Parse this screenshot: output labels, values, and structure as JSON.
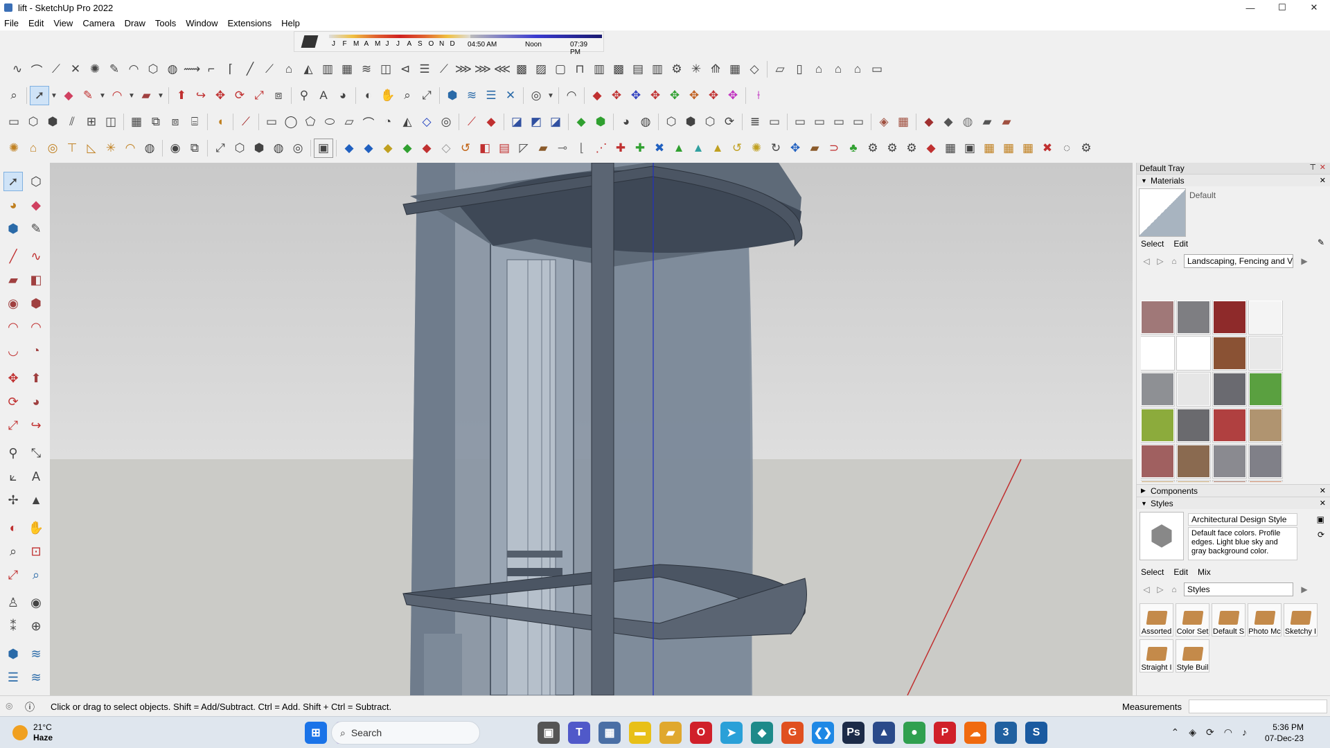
{
  "window": {
    "title": "lift - SketchUp Pro 2022",
    "minimize": "—",
    "maximize": "☐",
    "close": "✕"
  },
  "menu": [
    "File",
    "Edit",
    "View",
    "Camera",
    "Draw",
    "Tools",
    "Window",
    "Extensions",
    "Help"
  ],
  "shadows": {
    "months": [
      "J",
      "F",
      "M",
      "A",
      "M",
      "J",
      "J",
      "A",
      "S",
      "O",
      "N",
      "D"
    ],
    "sunrise": "04:50 AM",
    "noon": "Noon",
    "sunset": "07:39 PM"
  },
  "tray": {
    "title": "Default Tray",
    "materials": {
      "header": "Materials",
      "current": "Default",
      "tabs": [
        "Select",
        "Edit"
      ],
      "library": "Landscaping, Fencing and Ve",
      "swatch_colors": [
        "#a07878",
        "#7e7e82",
        "#8e2a2a",
        "#f4f4f4",
        "#ffffff",
        "#ffffff",
        "#8a5234",
        "#e8e8e8",
        "#8e9094",
        "#e6e6e6",
        "#6a6a70",
        "#5aa040",
        "#8cab3c",
        "#6a6a6e",
        "#b04040",
        "#b09470",
        "#a06060",
        "#8a6a50",
        "#8a8a90",
        "#808088",
        "#c0a070",
        "#c0a070",
        "#a07060",
        "#c08060"
      ]
    },
    "components": {
      "header": "Components"
    },
    "styles": {
      "header": "Styles",
      "name": "Architectural Design Style",
      "description": "Default face colors. Profile edges. Light blue sky and gray background color.",
      "tabs": [
        "Select",
        "Edit",
        "Mix"
      ],
      "library": "Styles",
      "folders": [
        "Assorted",
        "Color Set",
        "Default S",
        "Photo Mc",
        "Sketchy I",
        "Straight I",
        "Style Buil"
      ]
    }
  },
  "status": {
    "message": "Click or drag to select objects. Shift = Add/Subtract. Ctrl = Add. Shift + Ctrl = Subtract.",
    "measurements_label": "Measurements",
    "measurements_value": ""
  },
  "taskbar": {
    "temp": "21°C",
    "weather": "Haze",
    "search_placeholder": "Search",
    "time": "5:36 PM",
    "date": "07-Dec-23",
    "apps": [
      {
        "name": "start",
        "glyph": "⊞",
        "color": "#1a73e8"
      },
      {
        "name": "copilot",
        "glyph": "✦",
        "color": "#8a5cd0"
      },
      {
        "name": "task-view",
        "glyph": "▣",
        "color": "#555555"
      },
      {
        "name": "teams",
        "glyph": "T",
        "color": "#5059c9"
      },
      {
        "name": "calculator",
        "glyph": "▦",
        "color": "#4a6fa5"
      },
      {
        "name": "sticky-notes",
        "glyph": "▬",
        "color": "#e8c018"
      },
      {
        "name": "file-explorer",
        "glyph": "▰",
        "color": "#e0a82e"
      },
      {
        "name": "opera",
        "glyph": "O",
        "color": "#d0202a"
      },
      {
        "name": "telegram",
        "glyph": "➤",
        "color": "#2aa0d8"
      },
      {
        "name": "sketch-app",
        "glyph": "◆",
        "color": "#1e8a8a"
      },
      {
        "name": "grammarly",
        "glyph": "G",
        "color": "#e05020"
      },
      {
        "name": "vscode",
        "glyph": "❮❯",
        "color": "#1e88e5"
      },
      {
        "name": "photoshop",
        "glyph": "Ps",
        "color": "#1c2b48"
      },
      {
        "name": "vectorworks",
        "glyph": "▲",
        "color": "#2a4a8a"
      },
      {
        "name": "chrome",
        "glyph": "●",
        "color": "#30a050"
      },
      {
        "name": "pinterest",
        "glyph": "P",
        "color": "#d0202a"
      },
      {
        "name": "soundcloud",
        "glyph": "☁",
        "color": "#f06a10"
      },
      {
        "name": "app-3",
        "glyph": "3",
        "color": "#2060a0"
      },
      {
        "name": "sketchup",
        "glyph": "S",
        "color": "#1a5aa0"
      }
    ],
    "tray_glyphs": [
      "⌃",
      "◈",
      "⟳",
      "◠",
      "♪"
    ]
  }
}
